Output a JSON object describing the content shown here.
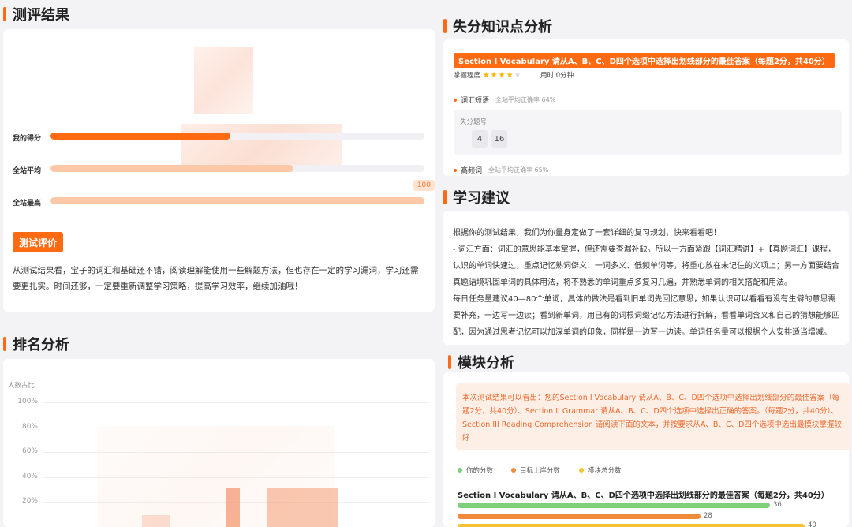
{
  "eval": {
    "title": "测评结果",
    "my_score_label": "我的得分",
    "avg_label": "全站平均",
    "max_label": "全站最高",
    "max_badge": "100",
    "my_score_fraction": 0.48,
    "avg_fraction": 0.65,
    "max_fraction": 1.0,
    "button": "测试评价",
    "text": "从测试结果看，宝子的词汇和基础还不错，阅读理解能使用一些解题方法，但也存在一定的学习漏洞，学习还需要更扎实。时间还够，一定要重新调整学习策略，提高学习效率，继续加油哦！"
  },
  "rank": {
    "title": "排名分析",
    "ylabel": "人数占比",
    "yticks": [
      "100%",
      "80%",
      "60%",
      "40%",
      "20%"
    ]
  },
  "loss": {
    "title": "失分知识点分析",
    "section_head": "Section I Vocabulary 请从A、B、C、D四个选项中选择出划线部分的最佳答案（每题2分，共40分）",
    "mastery_label": "掌握程度",
    "mastery_stars": 4,
    "time_label": "用时 0分钟",
    "kp1_name": "词汇短语",
    "kp1_rate": "全站平均正确率 64%",
    "lost_label": "失分题号",
    "lost_nums": [
      "4",
      "16"
    ],
    "kp2_name": "高频词",
    "kp2_rate": "全站平均正确率 65%"
  },
  "advice": {
    "title": "学习建议",
    "lines": [
      "根据你的测试结果，我们为你量身定做了一套详细的复习规划，快来看看吧！",
      "- 词汇方面：词汇的意思能基本掌握，但还需要查漏补缺。所以一方面紧跟【词汇精讲】+【真题词汇】课程，认识的单词快速过，重点记忆熟词僻义、一词多义、低频单词等，将重心放在未记住的义项上；另一方面要结合真题语境巩固单词的具体用法，将不熟悉的单词重点多复习几遍，并熟悉单词的相关搭配和用法。",
      "每日任务量建议40—80个单词，具体的做法是看到旧单词先回忆意思，如果认识可以看看有没有生僻的意思需要补充，一边写一边读；看到新单词，用已有的词根词缀记忆方法进行拆解，看看单词含义和自己的猜想能够匹配，因为通过思考记忆可以加深单词的印象，同样是一边写一边读。单词任务量可以根据个人安排适当增减。"
    ]
  },
  "module": {
    "title": "模块分析",
    "summary": "本次测试结果可以看出：您的Section I Vocabulary 请从A、B、C、D四个选项中选择出划线部分的最佳答案（每题2分，共40分）、Section II Grammar 请从A、B、C、D四个选项中选择出正确的答案。（每题2分，共40分）、Section III Reading Comprehension 请阅读下面的文本，并按要求从A、B、C、D四个选项中选出最模块掌握较好",
    "legend": [
      {
        "label": "你的分数",
        "color": "#7fcf7a"
      },
      {
        "label": "目标上岸分数",
        "color": "#f28a3c"
      },
      {
        "label": "模块总分数",
        "color": "#f7c230"
      }
    ],
    "question": "Section I Vocabulary 请从A、B、C、D四个选项中选择出划线部分的最佳答案（每题2分，共40分）",
    "scores": [
      "36",
      "28",
      "40"
    ],
    "score_values": [
      36,
      28,
      40
    ],
    "score_max": 40
  }
}
